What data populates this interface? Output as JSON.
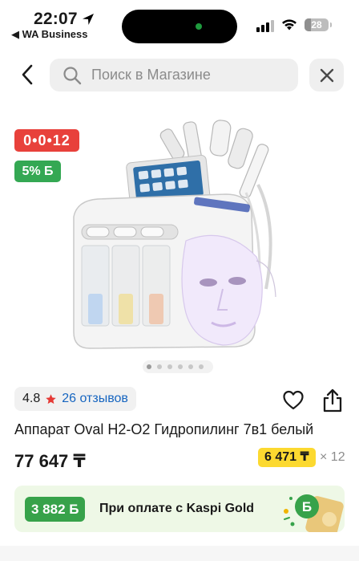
{
  "status_bar": {
    "time": "22:07",
    "back_app": "◀ WA Business",
    "battery": "28",
    "battery_level": 0.28
  },
  "search": {
    "placeholder": "Поиск в Магазине"
  },
  "badges": {
    "timer": "0•0•12",
    "discount": "5% Б"
  },
  "gallery": {
    "image_count": 6,
    "active_index": 0
  },
  "rating": {
    "score": "4.8",
    "reviews": "26 отзывов"
  },
  "product": {
    "title": "Аппарат Oval H2-O2 Гидропилинг 7в1 белый",
    "price": "77 647 ₸",
    "installment_price": "6 471 ₸",
    "installment_months": "× 12"
  },
  "kaspi_gold": {
    "amount": "3 882 Б",
    "text": "При оплате с Kaspi Gold"
  },
  "colors": {
    "timer_badge": "#e8413b",
    "discount_badge": "#34a853",
    "installment_badge": "#fcd930",
    "link": "#1665c0",
    "star": "#e53935"
  }
}
